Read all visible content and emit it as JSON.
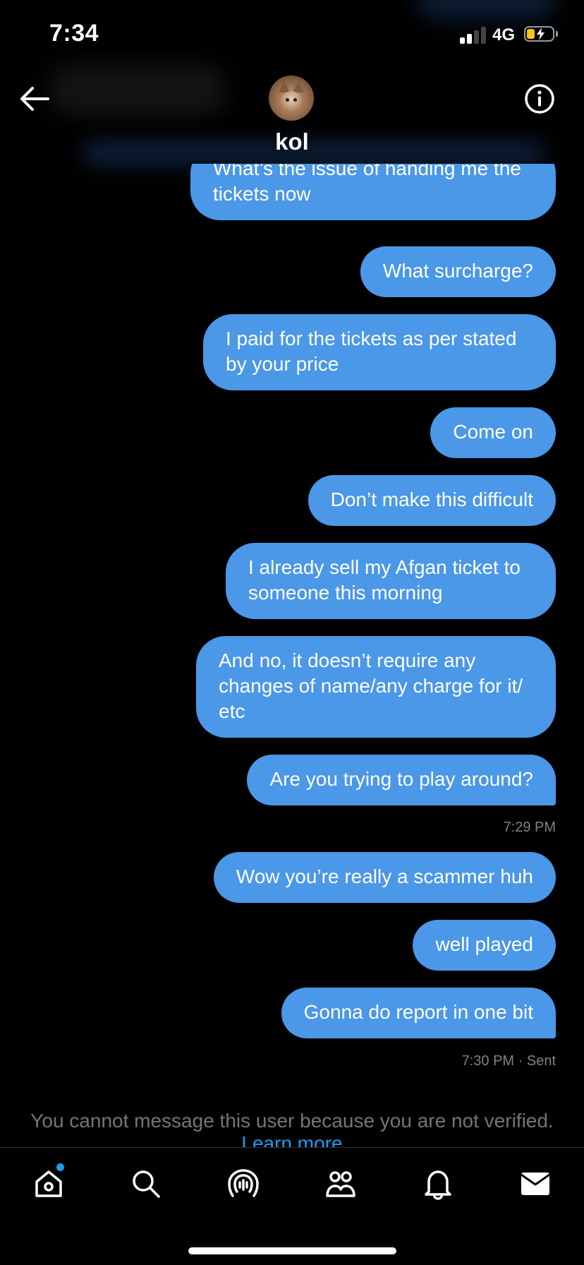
{
  "status_bar": {
    "time": "7:34",
    "network": "4G",
    "battery_color": "#f5c518"
  },
  "header": {
    "contact_name": "kol",
    "back_icon": "arrow-left-icon",
    "info_icon": "info-circle-icon"
  },
  "messages": [
    {
      "text": "What’s the issue of handing me the tickets now"
    },
    {
      "text": "What surcharge?"
    },
    {
      "text": "I paid for the tickets as per stated by your price"
    },
    {
      "text": "Come on"
    },
    {
      "text": "Don’t make this difficult"
    },
    {
      "text": "I already sell my Afgan ticket to someone this morning"
    },
    {
      "text": "And no, it doesn’t require any changes of name/any charge for it/ etc"
    },
    {
      "text": "Are you trying to play around?"
    },
    {
      "text": "Wow you’re really a scammer huh"
    },
    {
      "text": "well played"
    },
    {
      "text": "Gonna do report in one bit"
    }
  ],
  "timestamps": {
    "first": "7:29 PM",
    "second": "7:30 PM",
    "second_status": "· Sent"
  },
  "notice": {
    "text": "You cannot message this user because you are not verified.",
    "link": "Learn more"
  },
  "tabs": [
    {
      "icon": "home-icon",
      "has_badge": true
    },
    {
      "icon": "search-icon"
    },
    {
      "icon": "spaces-icon"
    },
    {
      "icon": "communities-icon"
    },
    {
      "icon": "notifications-bell-icon"
    },
    {
      "icon": "messages-envelope-icon"
    }
  ],
  "colors": {
    "bubble": "#4b97e8",
    "link": "#1d9bf0",
    "background": "#000000"
  }
}
